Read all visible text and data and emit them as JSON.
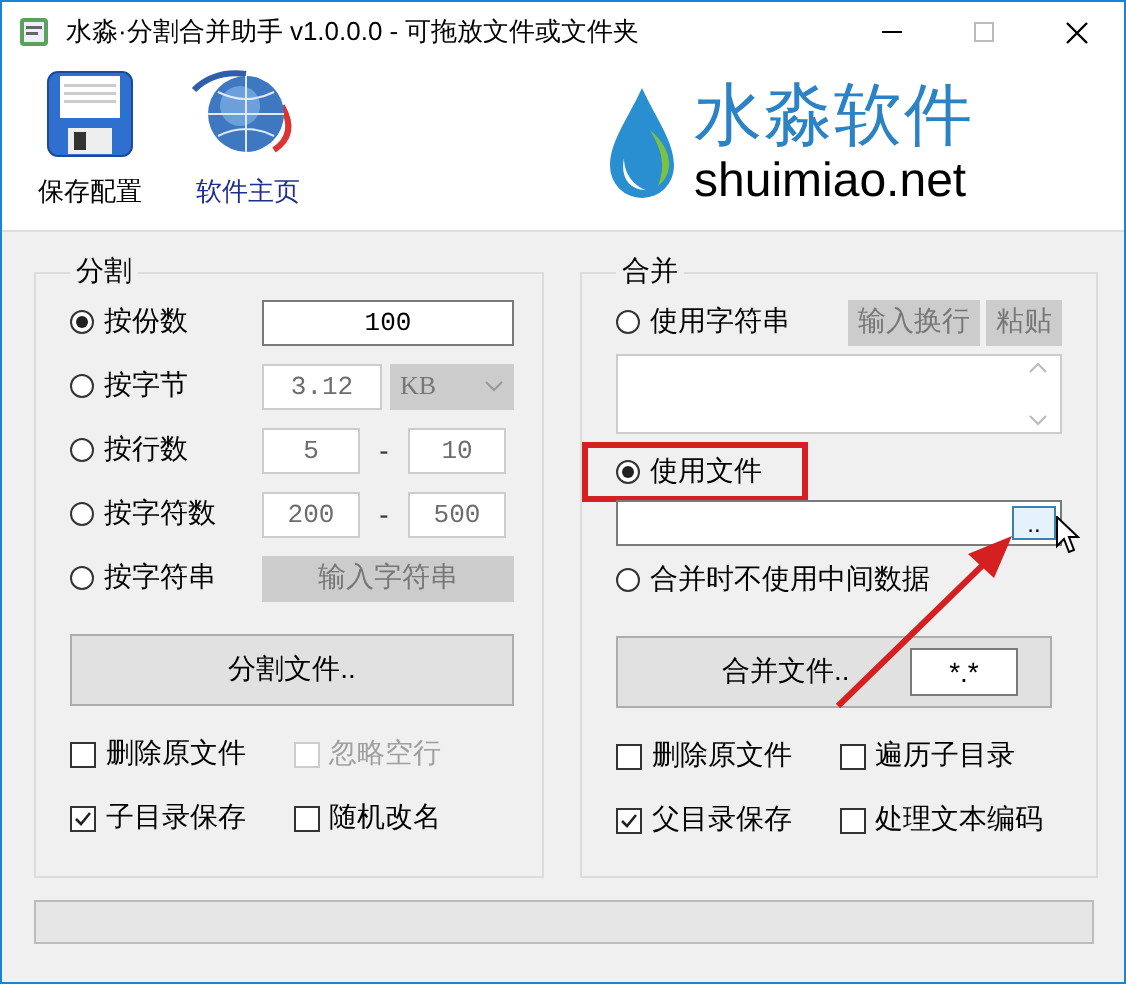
{
  "window": {
    "title": "水淼·分割合并助手 v1.0.0.0 - 可拖放文件或文件夹"
  },
  "toolbar": [
    {
      "label": "保存配置",
      "kind": "save"
    },
    {
      "label": "软件主页",
      "kind": "home"
    }
  ],
  "logo": {
    "name": "水淼软件",
    "domain": "shuimiao.net"
  },
  "split": {
    "title": "分割",
    "options": [
      {
        "label": "按份数",
        "kind": "field",
        "selected": true,
        "value": "100"
      },
      {
        "label": "按字节",
        "kind": "size",
        "selected": false,
        "value": "3.12",
        "unit": "KB"
      },
      {
        "label": "按行数",
        "kind": "range",
        "selected": false,
        "from": "5",
        "separator": "-",
        "to": "10"
      },
      {
        "label": "按字符数",
        "kind": "range",
        "selected": false,
        "from": "200",
        "separator": "-",
        "to": "500"
      },
      {
        "label": "按字符串",
        "kind": "button",
        "selected": false,
        "button": "输入字符串"
      }
    ],
    "action": "分割文件..",
    "checkboxes": [
      {
        "label": "删除原文件",
        "checked": false,
        "disabled": false
      },
      {
        "label": "忽略空行",
        "checked": false,
        "disabled": true
      },
      {
        "label": "子目录保存",
        "checked": true,
        "disabled": false
      },
      {
        "label": "随机改名",
        "checked": false,
        "disabled": false
      }
    ]
  },
  "merge": {
    "title": "合并",
    "options": [
      {
        "label": "使用字符串",
        "kind": "text",
        "selected": false,
        "highlighted": false,
        "buttons": [
          "输入换行",
          "粘贴"
        ]
      },
      {
        "label": "使用文件",
        "kind": "file",
        "selected": true,
        "highlighted": true,
        "browse": ".."
      },
      {
        "label": "合并时不使用中间数据",
        "kind": "plain",
        "selected": false,
        "highlighted": false
      }
    ],
    "action": "合并文件..",
    "pattern": "*.*",
    "checkboxes": [
      {
        "label": "删除原文件",
        "checked": false,
        "disabled": false
      },
      {
        "label": "遍历子目录",
        "checked": false,
        "disabled": false
      },
      {
        "label": "父目录保存",
        "checked": true,
        "disabled": false
      },
      {
        "label": "处理文本编码",
        "checked": false,
        "disabled": false
      }
    ]
  },
  "progress": {
    "level": 0
  }
}
